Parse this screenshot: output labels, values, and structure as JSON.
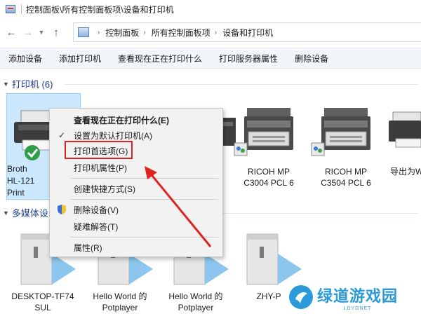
{
  "window": {
    "title": "控制面板\\所有控制面板项\\设备和打印机",
    "address_crumbs": [
      "控制面板",
      "所有控制面板项",
      "设备和打印机"
    ]
  },
  "toolbar": {
    "add_device": "添加设备",
    "add_printer": "添加打印机",
    "see_printing": "查看现在正在打印什么",
    "print_server_props": "打印服务器属性",
    "remove_device": "删除设备"
  },
  "groups": {
    "printers": {
      "label": "打印机 (6)"
    },
    "multimedia": {
      "label": "多媒体设"
    }
  },
  "printers": [
    {
      "line1": "Broth",
      "line2": "HL-121",
      "line3": "Print",
      "default": true
    },
    {
      "line1": "RICOH MP",
      "line2": "C3004 PCL 6"
    },
    {
      "line1": "RICOH MP",
      "line2": "C3504 PCL 6"
    },
    {
      "line1": "导出为W"
    }
  ],
  "media_devices": [
    {
      "line1": "DESKTOP-TF74",
      "line2": "SUL"
    },
    {
      "line1": "Hello World 的",
      "line2": "Potplayer"
    },
    {
      "line1": "Hello World 的",
      "line2": "Potplayer"
    },
    {
      "line1": "ZHY-P"
    }
  ],
  "context_menu": {
    "see_printing": "查看现在正在打印什么(E)",
    "set_default": "设置为默认打印机(A)",
    "printing_prefs": "打印首选项(G)",
    "printer_props": "打印机属性(P)",
    "create_shortcut": "创建快捷方式(S)",
    "remove_device": "删除设备(V)",
    "troubleshoot": "疑难解答(T)",
    "properties": "属性(R)"
  },
  "watermark": {
    "title": "绿道游戏园",
    "url": "LDYGNET"
  },
  "colors": {
    "accent": "#1e3c8c",
    "selection": "#cce8ff",
    "highlight_box": "#e02222",
    "arrow": "#e02222",
    "watermark": "#2b9ad8"
  }
}
